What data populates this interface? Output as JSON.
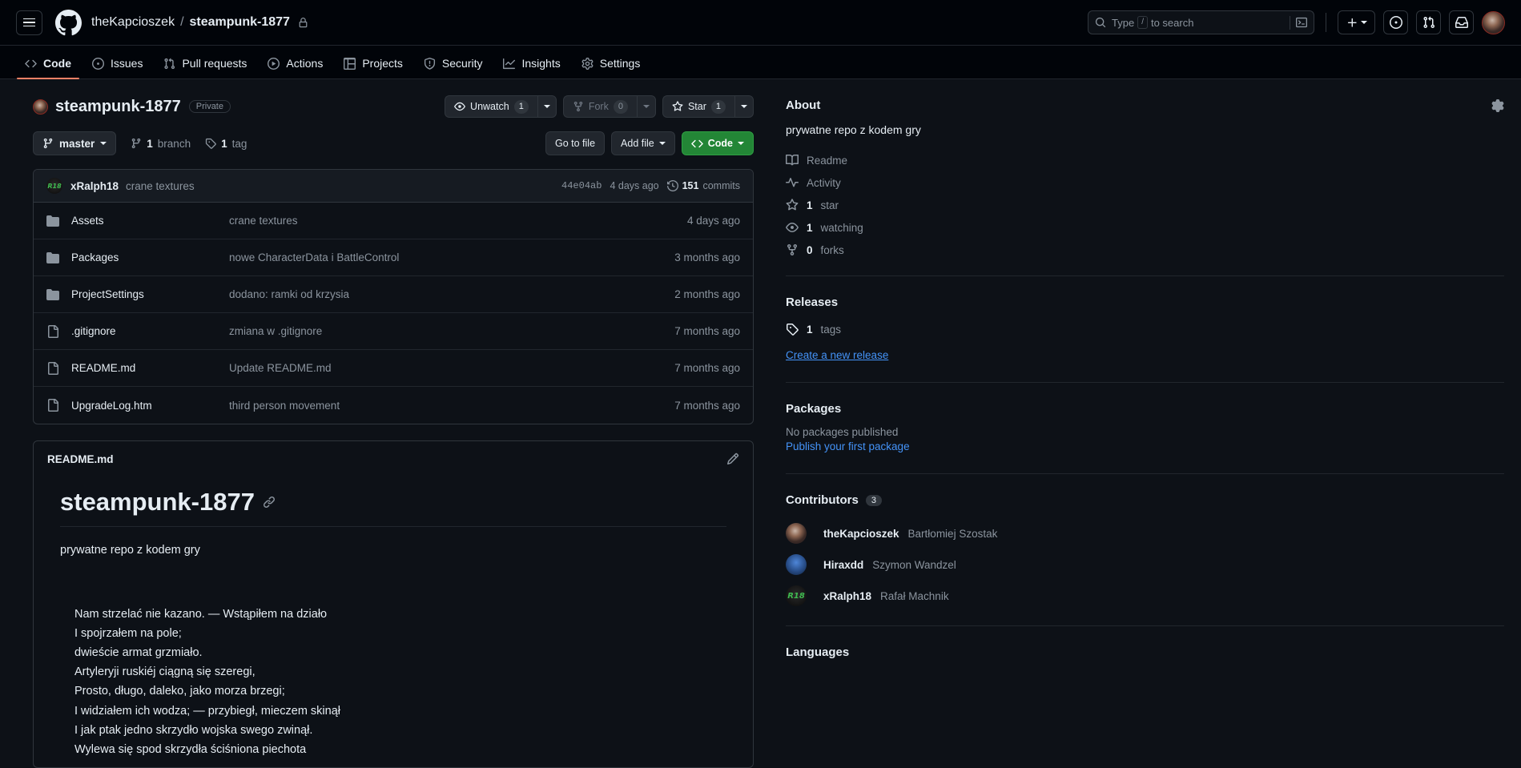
{
  "header": {
    "breadcrumb": {
      "owner": "theKapcioszek",
      "separator": "/",
      "repo": "steampunk-1877"
    },
    "search": {
      "placeholder_pre": "Type",
      "key": "/",
      "placeholder_post": "to search"
    }
  },
  "repo_nav": {
    "tabs": [
      {
        "label": "Code",
        "icon": "code-icon",
        "active": true
      },
      {
        "label": "Issues",
        "icon": "issue-opened-icon",
        "active": false
      },
      {
        "label": "Pull requests",
        "icon": "git-pull-request-icon",
        "active": false
      },
      {
        "label": "Actions",
        "icon": "play-icon",
        "active": false
      },
      {
        "label": "Projects",
        "icon": "table-icon",
        "active": false
      },
      {
        "label": "Security",
        "icon": "shield-icon",
        "active": false
      },
      {
        "label": "Insights",
        "icon": "graph-icon",
        "active": false
      },
      {
        "label": "Settings",
        "icon": "gear-icon",
        "active": false
      }
    ]
  },
  "repo_header": {
    "name": "steampunk-1877",
    "visibility": "Private",
    "watch": {
      "label": "Unwatch",
      "count": "1"
    },
    "fork": {
      "label": "Fork",
      "count": "0"
    },
    "star": {
      "label": "Star",
      "count": "1"
    }
  },
  "toolbar": {
    "branch": "master",
    "branch_count": "1",
    "branch_word": "branch",
    "tag_count": "1",
    "tag_word": "tag",
    "go_to_file": "Go to file",
    "add_file": "Add file",
    "code": "Code"
  },
  "commit_bar": {
    "author": "xRalph18",
    "message": "crane textures",
    "hash": "44e04ab",
    "age": "4 days ago",
    "commits_count": "151",
    "commits_word": "commits"
  },
  "files": [
    {
      "name": "Assets",
      "type": "folder",
      "message": "crane textures",
      "age": "4 days ago"
    },
    {
      "name": "Packages",
      "type": "folder",
      "message": "nowe CharacterData i BattleControl",
      "age": "3 months ago"
    },
    {
      "name": "ProjectSettings",
      "type": "folder",
      "message": "dodano: ramki od krzysia",
      "age": "2 months ago"
    },
    {
      "name": ".gitignore",
      "type": "file",
      "message": "zmiana w .gitignore",
      "age": "7 months ago"
    },
    {
      "name": "README.md",
      "type": "file",
      "message": "Update README.md",
      "age": "7 months ago"
    },
    {
      "name": "UpgradeLog.htm",
      "type": "file",
      "message": "third person movement",
      "age": "7 months ago"
    }
  ],
  "readme": {
    "filename": "README.md",
    "heading": "steampunk-1877",
    "paragraph": "prywatne repo z kodem gry",
    "poem_lines": [
      "Nam strzelać nie kazano. — Wstąpiłem na działo",
      "I spojrzałem na pole;",
      "dwieście armat grzmiało.",
      "Artyleryji ruskiéj ciągną się szeregi,",
      "Prosto, długo, daleko, jako morza brzegi;",
      "I widziałem ich wodza; — przybiegł, mieczem skinął",
      "I jak ptak jedno skrzydło wojska swego zwinął.",
      "Wylewa się spod skrzydła ściśniona piechota"
    ]
  },
  "sidebar": {
    "about": {
      "title": "About",
      "description": "prywatne repo z kodem gry",
      "links": [
        {
          "label": "Readme",
          "icon": "book-icon"
        },
        {
          "label": "Activity",
          "icon": "pulse-icon"
        }
      ],
      "stats": [
        {
          "count": "1",
          "label": "star",
          "icon": "star-icon"
        },
        {
          "count": "1",
          "label": "watching",
          "icon": "eye-icon"
        },
        {
          "count": "0",
          "label": "forks",
          "icon": "fork-icon"
        }
      ]
    },
    "releases": {
      "title": "Releases",
      "tags_count": "1",
      "tags_word": "tags",
      "create_link": "Create a new release"
    },
    "packages": {
      "title": "Packages",
      "empty": "No packages published",
      "publish_link": "Publish your first package"
    },
    "contributors": {
      "title": "Contributors",
      "count": "3",
      "people": [
        {
          "username": "theKapcioszek",
          "realname": "Bartłomiej Szostak",
          "avatar": "kapcioszek"
        },
        {
          "username": "Hiraxdd",
          "realname": "Szymon Wandzel",
          "avatar": "hiraxdd"
        },
        {
          "username": "xRalph18",
          "realname": "Rafał Machnik",
          "avatar": "ralph18"
        }
      ]
    },
    "languages": {
      "title": "Languages"
    }
  },
  "colors": {
    "accent_green": "#238636",
    "link_blue": "#4493f8",
    "active_tab": "#f78166",
    "bg": "#0d1117"
  }
}
